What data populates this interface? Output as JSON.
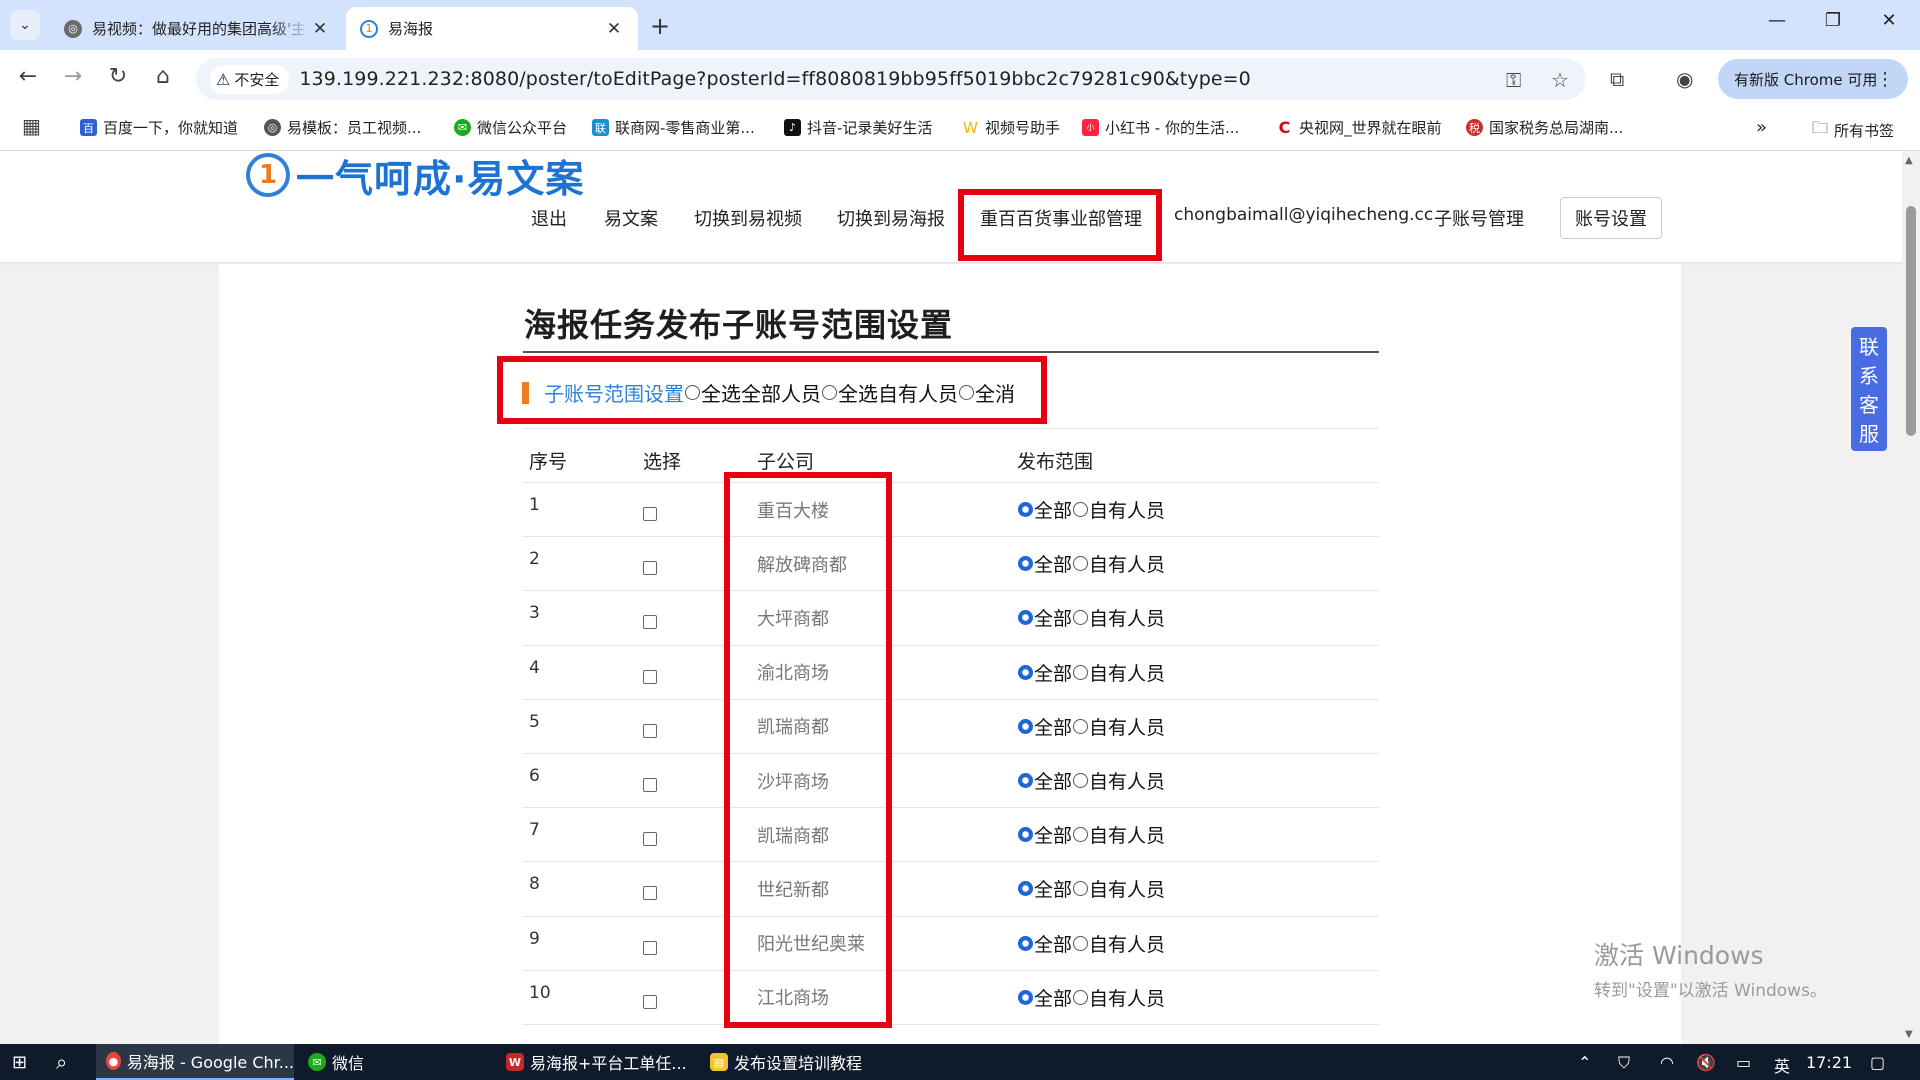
{
  "browser": {
    "tabs": [
      {
        "title": "易视频：做最好用的集团高级'主",
        "active": false
      },
      {
        "title": "易海报",
        "active": true
      }
    ],
    "new_tab": "+",
    "window_controls": {
      "minimize": "—",
      "maximize": "❐",
      "close": "✕"
    },
    "security_label": "不安全",
    "url": "139.199.221.232:8080/poster/toEditPage?posterId=ff8080819bb95ff5019bbc2c79281c90&type=0",
    "update_button": "有新版 Chrome 可用",
    "bookmarks": [
      {
        "label": "百度一下，你就知道",
        "color": "#2f5fd8"
      },
      {
        "label": "易模板：员工视频...",
        "color": "#555555"
      },
      {
        "label": "微信公众平台",
        "color": "#1aad19"
      },
      {
        "label": "联商网-零售商业第...",
        "color": "#1f8fcf"
      },
      {
        "label": "抖音-记录美好生活",
        "color": "#111111"
      },
      {
        "label": "视频号助手",
        "color": "#f7b500"
      },
      {
        "label": "小红书 - 你的生活...",
        "color": "#ff2442"
      },
      {
        "label": "央视网_世界就在眼前",
        "color": "#d0021b"
      },
      {
        "label": "国家税务总局湖南...",
        "color": "#c9302c"
      }
    ],
    "more_bookmarks": "»",
    "all_bookmarks": "所有书签"
  },
  "site": {
    "logo_text": "一气呵成·易文案",
    "nav": [
      "退出",
      "易文案",
      "切换到易视频",
      "切换到易海报",
      "重百百货事业部管理",
      "chongbaimall@yiqihecheng.cc",
      "子账号管理"
    ],
    "account_button": "账号设置",
    "contact_widget": [
      "联",
      "系",
      "客",
      "服"
    ]
  },
  "main": {
    "title": "海报任务发布子账号范围设置",
    "section_label": "子账号范围设置",
    "select_options": [
      "全选全部人员",
      "全选自有人员",
      "全消"
    ],
    "table": {
      "headers": [
        "序号",
        "选择",
        "子公司",
        "发布范围"
      ],
      "scope_options": [
        "全部",
        "自有人员"
      ],
      "rows": [
        {
          "no": "1",
          "company": "重百大楼",
          "checked": false,
          "scope": "全部"
        },
        {
          "no": "2",
          "company": "解放碑商都",
          "checked": false,
          "scope": "全部"
        },
        {
          "no": "3",
          "company": "大坪商都",
          "checked": false,
          "scope": "全部"
        },
        {
          "no": "4",
          "company": "渝北商场",
          "checked": false,
          "scope": "全部"
        },
        {
          "no": "5",
          "company": "凯瑞商都",
          "checked": false,
          "scope": "全部"
        },
        {
          "no": "6",
          "company": "沙坪商场",
          "checked": false,
          "scope": "全部"
        },
        {
          "no": "7",
          "company": "凯瑞商都",
          "checked": false,
          "scope": "全部"
        },
        {
          "no": "8",
          "company": "世纪新都",
          "checked": false,
          "scope": "全部"
        },
        {
          "no": "9",
          "company": "阳光世纪奥莱",
          "checked": false,
          "scope": "全部"
        },
        {
          "no": "10",
          "company": "江北商场",
          "checked": false,
          "scope": "全部"
        }
      ]
    }
  },
  "watermark": {
    "line1": "激活 Windows",
    "line2": "转到\"设置\"以激活 Windows。"
  },
  "taskbar": {
    "items": [
      {
        "label": "易海报 - Google Chr...",
        "active": true,
        "color": "#e8453c"
      },
      {
        "label": "微信",
        "active": false,
        "color": "#1aad19"
      },
      {
        "label": "易海报+平台工单任...",
        "active": false,
        "color": "#c62828"
      },
      {
        "label": "发布设置培训教程",
        "active": false,
        "color": "#f4c430"
      }
    ],
    "ime": "英",
    "time": "17:21"
  },
  "colors": {
    "annotation_red": "#e60012",
    "link_blue": "#2f80d8",
    "accent_orange": "#f07b1d",
    "contact_blue": "#4a6ce2"
  }
}
